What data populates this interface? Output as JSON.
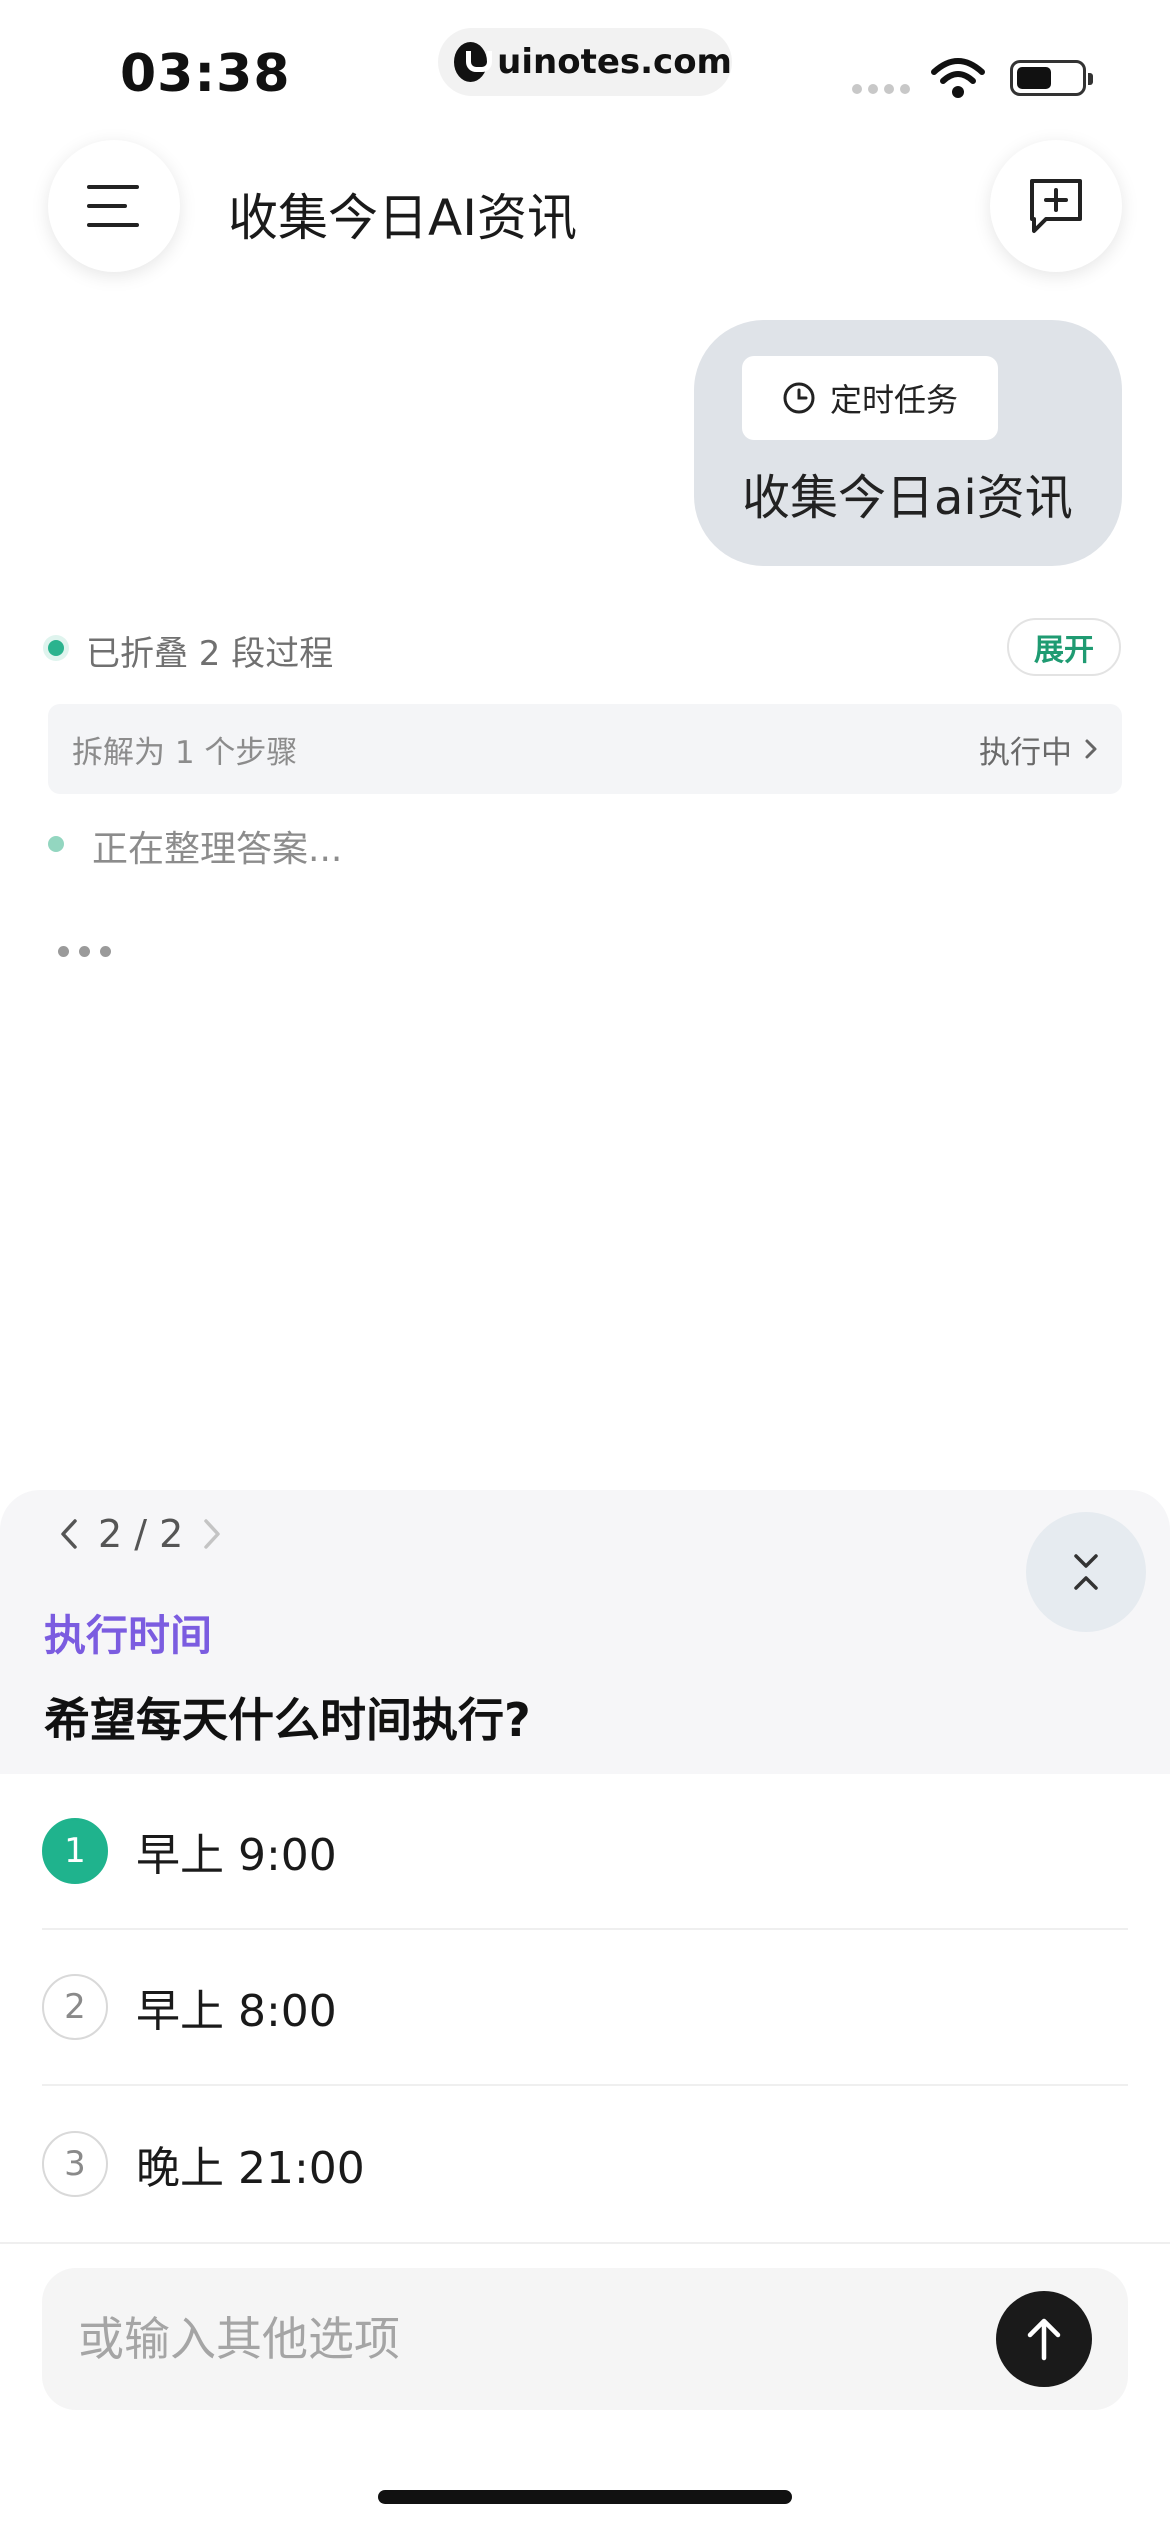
{
  "status_bar": {
    "time": "03:38",
    "url": "uinotes.com",
    "icons": [
      "signal-icon",
      "wifi-icon",
      "battery-icon"
    ]
  },
  "header": {
    "title": "收集今日AI资讯",
    "menu_icon": "menu-icon",
    "new_chat_icon": "new-chat-icon"
  },
  "user_message": {
    "chip_label": "定时任务",
    "chip_icon": "clock-icon",
    "text": "收集今日ai资讯"
  },
  "process": {
    "folded_text": "已折叠 2 段过程",
    "expand_label": "展开",
    "step_text": "拆解为 1 个步骤",
    "step_status": "执行中",
    "organizing_text": "正在整理答案..."
  },
  "question_sheet": {
    "pager": "2 / 2",
    "category": "执行时间",
    "title": "希望每天什么时间执行?",
    "options": [
      {
        "num": "1",
        "label": "早上 9:00",
        "selected": true
      },
      {
        "num": "2",
        "label": "早上 8:00",
        "selected": false
      },
      {
        "num": "3",
        "label": "晚上 21:00",
        "selected": false
      }
    ]
  },
  "input": {
    "placeholder": "或输入其他选项",
    "value": ""
  },
  "colors": {
    "accent_green": "#1fb38d",
    "category_purple": "#7b5ce0",
    "bubble_bg": "#dfe3e8",
    "send_button": "#1a1a1a"
  }
}
